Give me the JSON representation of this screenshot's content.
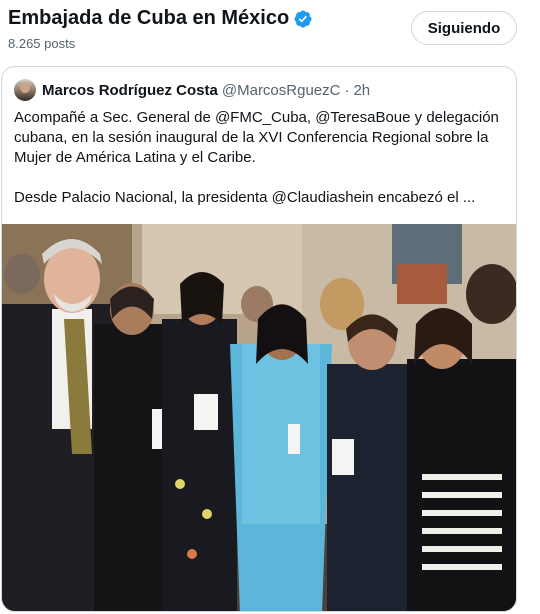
{
  "header": {
    "title": "Embajada de Cuba en México",
    "posts_count": "8.265 posts",
    "follow_label": "Siguiendo",
    "verified_color": "#1d9bf0"
  },
  "quote": {
    "author_name": "Marcos Rodríguez Costa",
    "author_handle": "@MarcosRguezC",
    "separator": "·",
    "time": "2h",
    "paragraph1": "Acompañé a Sec. General de @FMC_Cuba, @TeresaBoue y delegación cubana, en la sesión inaugural de la XVI Conferencia Regional sobre la Mujer de América Latina y el Caribe.",
    "paragraph2": "Desde Palacio Nacional, la presidenta @Claudiashein  encabezó el ..."
  },
  "icons": {
    "verified": "verified-badge-icon",
    "avatar": "avatar"
  },
  "colors": {
    "text_primary": "#0f1419",
    "text_secondary": "#536471",
    "border": "#cfd9de"
  }
}
